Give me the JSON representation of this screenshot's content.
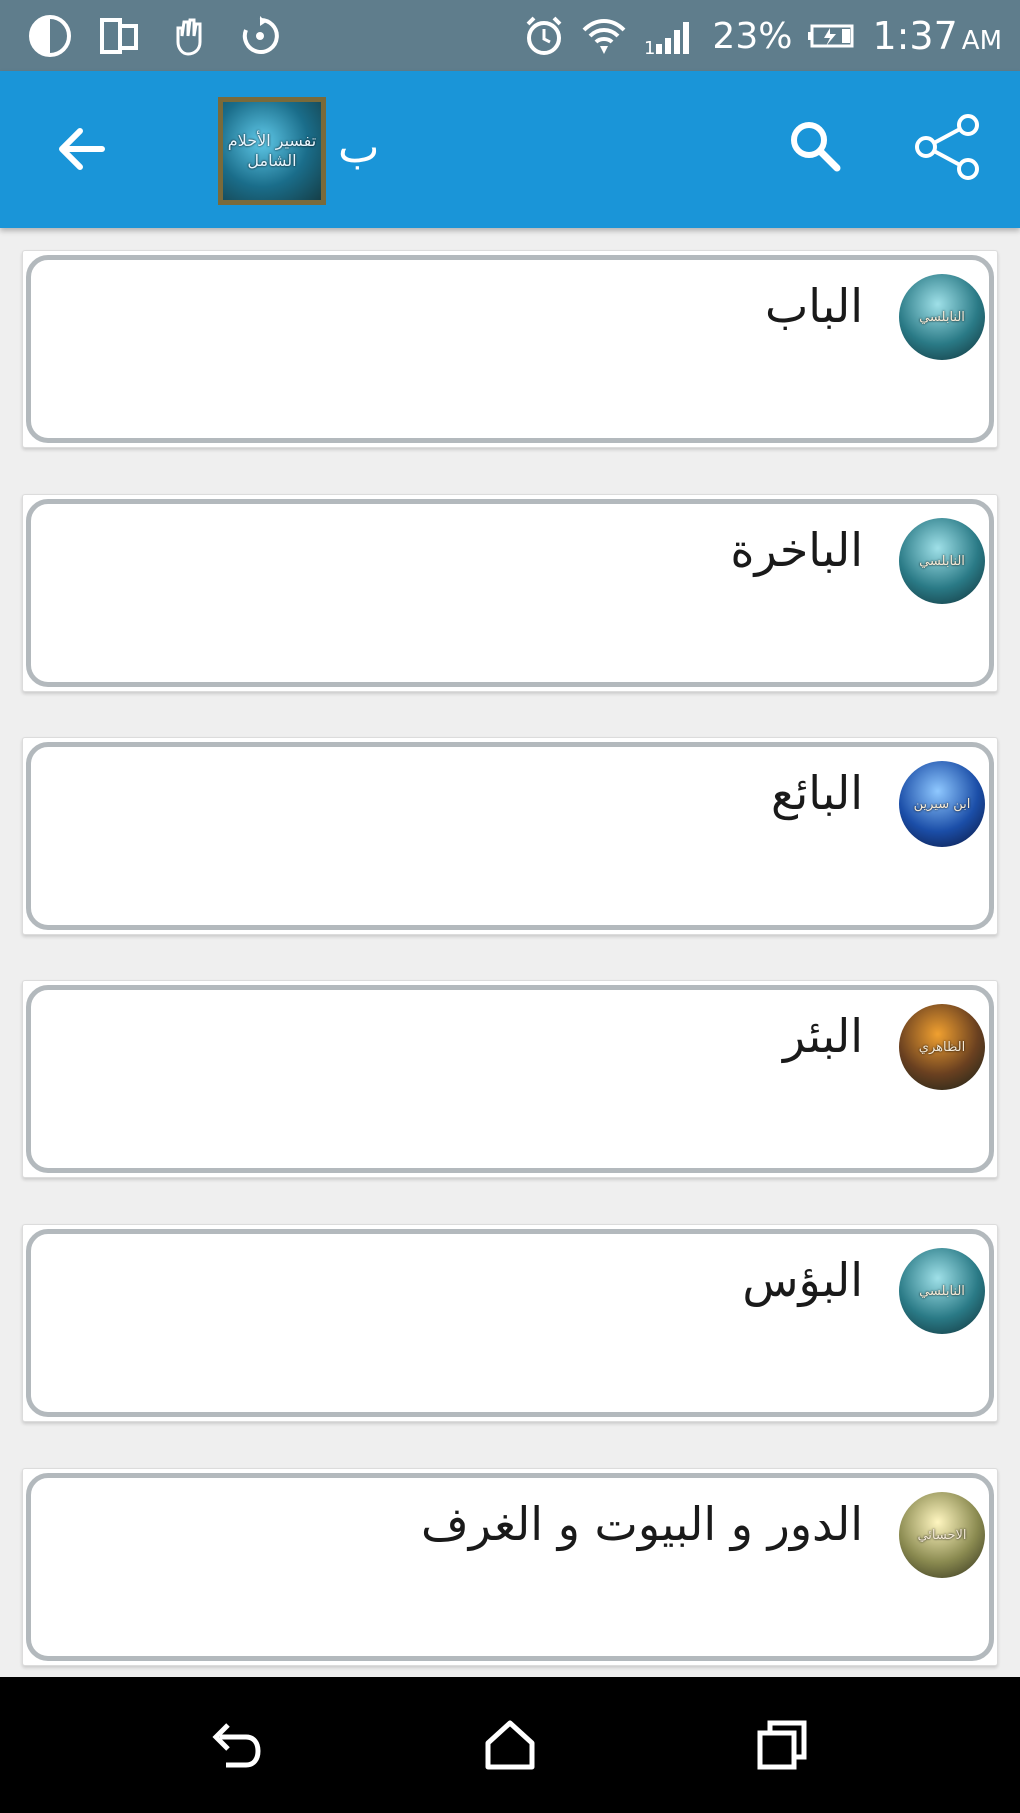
{
  "status_bar": {
    "battery": "23%",
    "time": "1:37",
    "ampm": "AM",
    "icons": [
      "theme-icon",
      "dual-screen-icon",
      "hand-icon",
      "sync-icon",
      "alarm-icon",
      "wifi-icon",
      "signal-icon",
      "battery-icon"
    ]
  },
  "app_bar": {
    "title": "ب",
    "logo_text": "تفسير الأحلام الشامل",
    "back_icon": "arrow-back-icon",
    "search_icon": "search-icon",
    "share_icon": "share-icon"
  },
  "items": [
    {
      "title": "الباب",
      "avatar_text": "النابلسي",
      "avatar_colors": [
        "#9fe0e8",
        "#2a7a86",
        "#0f2c33"
      ]
    },
    {
      "title": "الباخرة",
      "avatar_text": "النابلسي",
      "avatar_colors": [
        "#9fe0e8",
        "#2a7a86",
        "#0f2c33"
      ]
    },
    {
      "title": "البائع",
      "avatar_text": "ابن سيرين",
      "avatar_colors": [
        "#8fc8ff",
        "#1b4ea8",
        "#0a1236"
      ]
    },
    {
      "title": "البئر",
      "avatar_text": "الظاهري",
      "avatar_colors": [
        "#f0a030",
        "#6a4020",
        "#112018"
      ]
    },
    {
      "title": "البؤس",
      "avatar_text": "النابلسي",
      "avatar_colors": [
        "#9fe0e8",
        "#2a7a86",
        "#0f2c33"
      ]
    },
    {
      "title": "الدور و البيوت و الغرف",
      "avatar_text": "الاحسائي",
      "avatar_colors": [
        "#fff6c0",
        "#8a8a50",
        "#2a2a18"
      ]
    }
  ],
  "nav_bar": {
    "back_icon": "nav-back-icon",
    "home_icon": "nav-home-icon",
    "recents_icon": "nav-recents-icon"
  }
}
